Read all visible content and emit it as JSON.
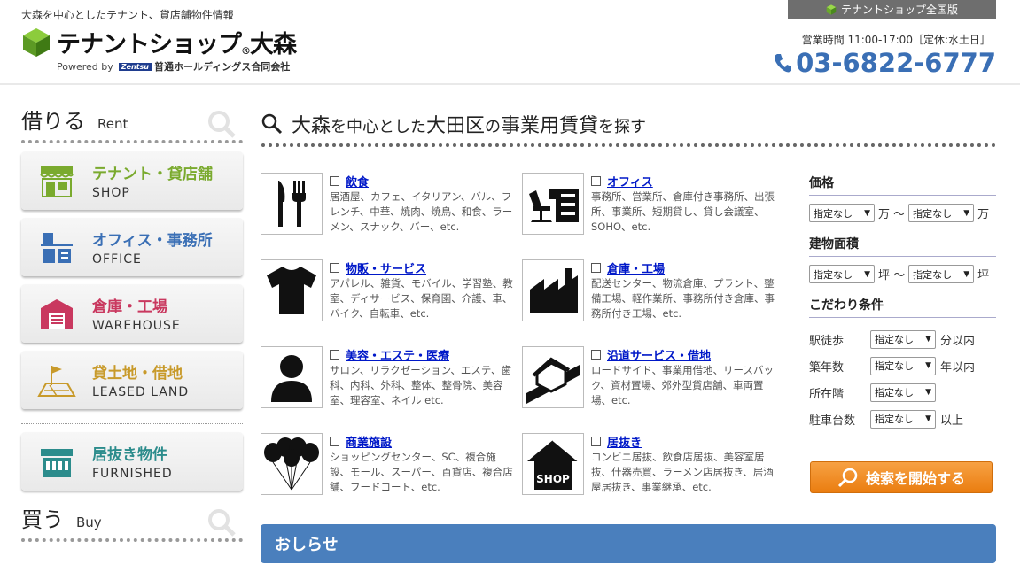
{
  "header": {
    "tagline": "大森を中心としたテナント、貸店舗物件情報",
    "logo_text": "テナントショップ",
    "logo_registered": "®",
    "logo_place": "大森",
    "powered_by": "Powered by",
    "powered_brand": "Zentsu",
    "powered_company": "普通ホールディングス合同会社",
    "national_link": "テナントショップ全国版",
    "hours": "営業時間 11:00-17:00［定休:水土日］",
    "phone": "03-6822-6777"
  },
  "sidebar": {
    "rent_title": "借りる",
    "rent_sub": "Rent",
    "items": [
      {
        "label": "テナント・貸店舗",
        "sub": "SHOP"
      },
      {
        "label": "オフィス・事務所",
        "sub": "OFFICE"
      },
      {
        "label": "倉庫・工場",
        "sub": "WAREHOUSE"
      },
      {
        "label": "貸土地・借地",
        "sub": "LEASED LAND"
      },
      {
        "label": "居抜き物件",
        "sub": "FURNISHED"
      }
    ],
    "buy_title": "買う",
    "buy_sub": "Buy"
  },
  "main": {
    "title_parts": [
      "大森",
      "を中心とした",
      "大田区",
      "の",
      "事業用賃貸",
      "を探す"
    ],
    "categories": [
      {
        "label": "飲食",
        "desc": "居酒屋、カフェ、イタリアン、バル、フレンチ、中華、焼肉、焼鳥、和食、ラーメン、スナック、バー、etc."
      },
      {
        "label": "オフィス",
        "desc": "事務所、営業所、倉庫付き事務所、出張所、事業所、短期貸し、貸し会議室、SOHO、etc."
      },
      {
        "label": "物販・サービス",
        "desc": "アパレル、雑貨、モバイル、学習塾、教室、ディサービス、保育園、介護、車、バイク、自転車、etc."
      },
      {
        "label": "倉庫・工場",
        "desc": "配送センター、物流倉庫、プラント、整備工場、軽作業所、事務所付き倉庫、事務所付き工場、etc."
      },
      {
        "label": "美容・エステ・医療",
        "desc": "サロン、リラクゼーション、エステ、歯科、内科、外科、整体、整骨院、美容室、理容室、ネイル etc."
      },
      {
        "label": "沿道サービス・借地",
        "desc": "ロードサイド、事業用借地、リースバック、資材置場、郊外型貸店舗、車両置場、etc."
      },
      {
        "label": "商業施設",
        "desc": "ショッピングセンター、SC、複合施設、モール、スーパー、百貨店、複合店舗、フードコート、etc."
      },
      {
        "label": "居抜き",
        "desc": "コンビニ居抜、飲食店居抜、美容室居抜、什器売買、ラーメン店居抜き、居酒屋居抜き、事業継承、etc."
      }
    ],
    "shop_icon_text": "SHOP",
    "news_title": "おしらせ"
  },
  "filter": {
    "price_title": "価格",
    "price_from": "指定なし",
    "price_unit_a": "万 〜",
    "price_to": "指定なし",
    "price_unit_b": "万",
    "area_title": "建物面積",
    "area_from": "指定なし",
    "area_unit_a": "坪 〜",
    "area_to": "指定なし",
    "area_unit_b": "坪",
    "kodawari_title": "こだわり条件",
    "rows": [
      {
        "label": "駅徒歩",
        "value": "指定なし",
        "suffix": "分以内"
      },
      {
        "label": "築年数",
        "value": "指定なし",
        "suffix": "年以内"
      },
      {
        "label": "所在階",
        "value": "指定なし",
        "suffix": ""
      },
      {
        "label": "駐車台数",
        "value": "指定なし",
        "suffix": "以上"
      }
    ],
    "search_button": "検索を開始する"
  },
  "colors": {
    "accent_blue": "#3a6fb5",
    "news_blue": "#4a7fbd",
    "search_orange": "#ee8a1e",
    "logo_green": "#6aa82c"
  }
}
